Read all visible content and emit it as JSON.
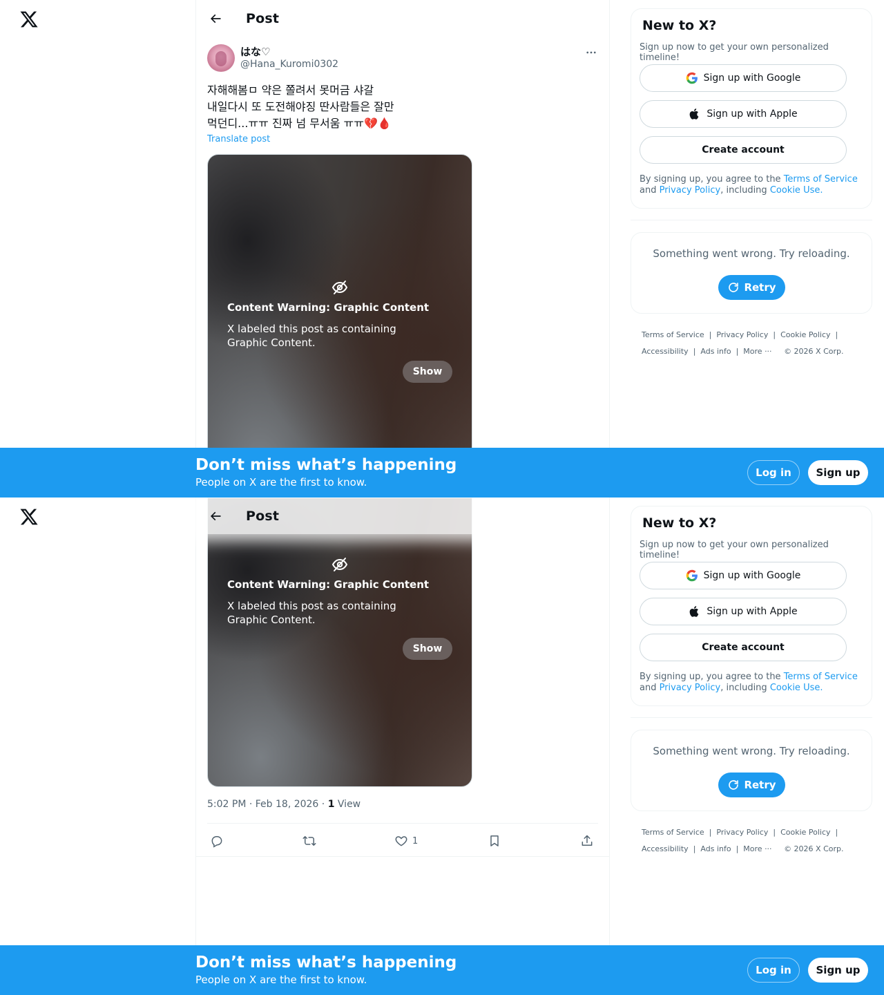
{
  "nav": {
    "logo_icon": "x-logo-icon"
  },
  "header": {
    "title": "Post"
  },
  "post": {
    "author_name": "はな♡",
    "author_handle": "@Hana_Kuromi0302",
    "text": "자해해봄ㅁ 약은 쫄려서 못머금 샤갈\n내일다시 또 도전해야징 딴사람들은 잘만\n먹던디...ㅠㅠ 진짜 넘 무서움 ㅠㅠ💔🩸",
    "translate": "Translate post",
    "warning_title": "Content Warning: Graphic Content",
    "warning_desc": "X labeled this post as containing Graphic Content.",
    "show_label": "Show",
    "time": "5:02 PM · Feb 18, 2026 · ",
    "views_count": "1",
    "views_label": " View",
    "like_count": "1"
  },
  "signup": {
    "heading": "New to X?",
    "subtitle": "Sign up now to get your own personalized timeline!",
    "google": "Sign up with Google",
    "apple": "Sign up with Apple",
    "create": "Create account",
    "terms_prefix": "By signing up, you agree to the ",
    "terms_link": "Terms of Service",
    "terms_and": " and ",
    "privacy_link": "Privacy Policy",
    "including": ", including ",
    "cookie_link": "Cookie Use."
  },
  "error": {
    "message": "Something went wrong. Try reloading.",
    "retry": "Retry"
  },
  "footer": {
    "terms": "Terms of Service",
    "privacy": "Privacy Policy",
    "cookie": "Cookie Policy",
    "accessibility": "Accessibility",
    "ads": "Ads info",
    "more": "More ···",
    "copyright": "© 2026 X Corp."
  },
  "banner": {
    "title": "Don’t miss what’s happening",
    "subtitle": "People on X are the first to know.",
    "login": "Log in",
    "signup": "Sign up"
  },
  "colors": {
    "accent": "#1d9bf0",
    "text": "#0f1419",
    "muted": "#536471",
    "border": "#eff3f4"
  }
}
